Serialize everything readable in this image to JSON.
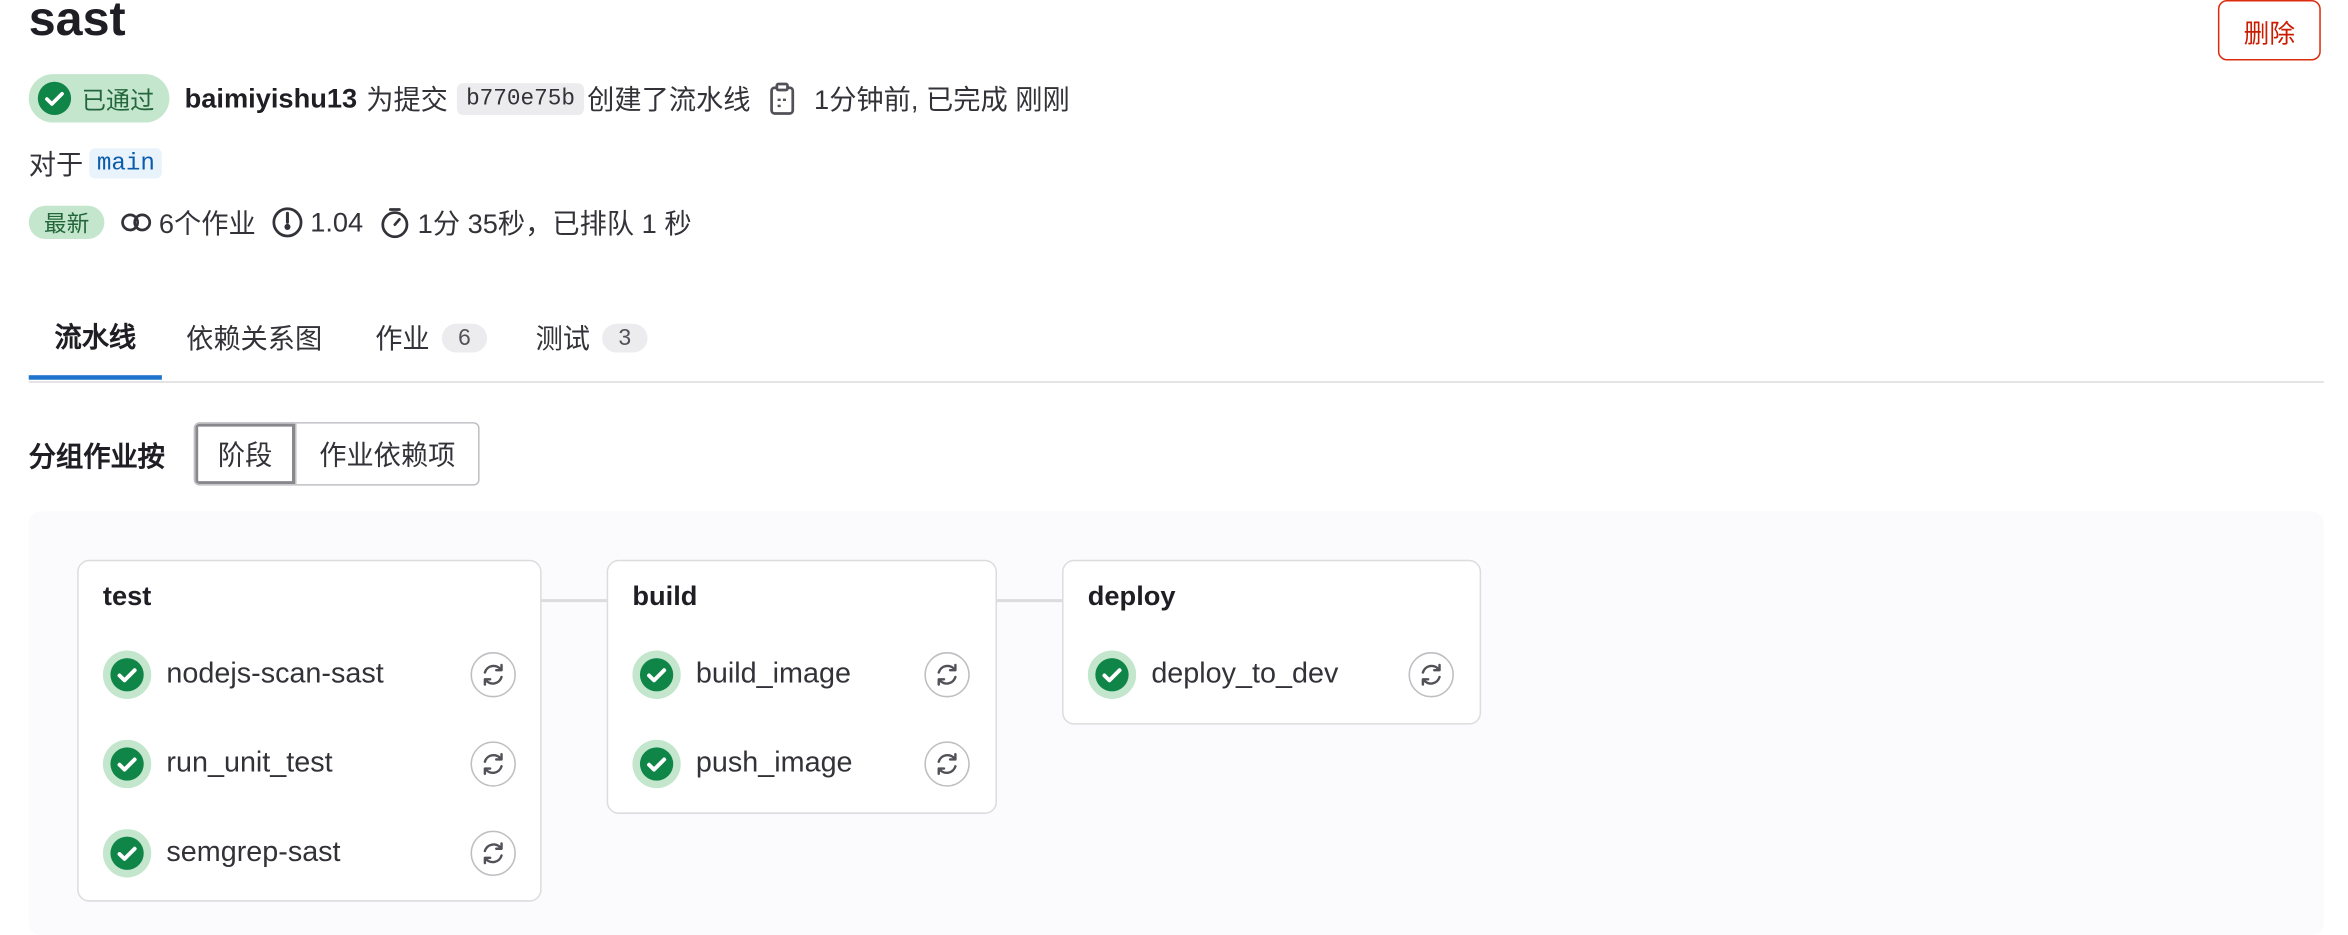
{
  "pipeline": {
    "title": "sast",
    "delete_label": "删除",
    "status_label": "已通过",
    "author": "baimiyishu13",
    "for_commit_text": "为提交",
    "commit_sha": "b770e75b",
    "created_text": "创建了流水线",
    "time_text": "1分钟前, 已完成 刚刚",
    "for_text": "对于",
    "branch": "main",
    "latest_label": "最新",
    "jobs_summary": "6个作业",
    "duration_score": "1.04",
    "duration_text": "1分 35秒，已排队 1 秒"
  },
  "tabs": [
    {
      "label": "流水线",
      "count": null
    },
    {
      "label": "依赖关系图",
      "count": null
    },
    {
      "label": "作业",
      "count": "6"
    },
    {
      "label": "测试",
      "count": "3"
    }
  ],
  "group_by": {
    "label": "分组作业按",
    "options": [
      "阶段",
      "作业依赖项"
    ],
    "selected": "阶段"
  },
  "stages": [
    {
      "name": "test",
      "jobs": [
        "nodejs-scan-sast",
        "run_unit_test",
        "semgrep-sast"
      ]
    },
    {
      "name": "build",
      "jobs": [
        "build_image",
        "push_image"
      ]
    },
    {
      "name": "deploy",
      "jobs": [
        "deploy_to_dev"
      ]
    }
  ],
  "colors": {
    "success": "#108548",
    "success_bg": "#c3e6cd",
    "danger": "#dd2b0e",
    "link": "#1f75cb"
  },
  "icons": {
    "status": "status-success-icon",
    "copy": "copy-to-clipboard-icon",
    "jobs": "pipeline-jobs-icon",
    "score": "speedometer-icon",
    "duration": "timer-icon",
    "retry": "retry-icon"
  }
}
